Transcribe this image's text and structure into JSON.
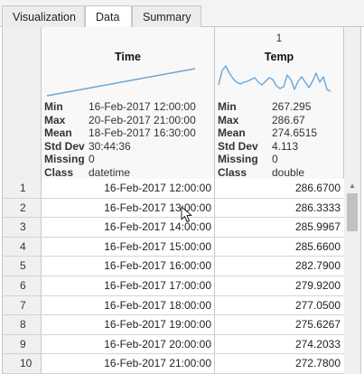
{
  "tabs": [
    {
      "label": "Visualization"
    },
    {
      "label": "Data"
    },
    {
      "label": "Summary"
    }
  ],
  "columns": {
    "time": {
      "name": "Time",
      "stats": [
        {
          "key": "Min",
          "value": "16-Feb-2017 12:00:00"
        },
        {
          "key": "Max",
          "value": "20-Feb-2017 21:00:00"
        },
        {
          "key": "Mean",
          "value": "18-Feb-2017 16:30:00"
        },
        {
          "key": "Std Dev",
          "value": "30:44:36"
        },
        {
          "key": "Missing",
          "value": "0"
        },
        {
          "key": "Class",
          "value": "datetime"
        }
      ]
    },
    "temp": {
      "number": "1",
      "name": "Temp",
      "stats": [
        {
          "key": "Min",
          "value": "267.295"
        },
        {
          "key": "Max",
          "value": "286.67"
        },
        {
          "key": "Mean",
          "value": "274.6515"
        },
        {
          "key": "Std Dev",
          "value": "4.113"
        },
        {
          "key": "Missing",
          "value": "0"
        },
        {
          "key": "Class",
          "value": "double"
        }
      ]
    }
  },
  "rows": [
    {
      "n": "1",
      "time": "16-Feb-2017 12:00:00",
      "temp": "286.6700"
    },
    {
      "n": "2",
      "time": "16-Feb-2017 13:00:00",
      "temp": "286.3333"
    },
    {
      "n": "3",
      "time": "16-Feb-2017 14:00:00",
      "temp": "285.9967"
    },
    {
      "n": "4",
      "time": "16-Feb-2017 15:00:00",
      "temp": "285.6600"
    },
    {
      "n": "5",
      "time": "16-Feb-2017 16:00:00",
      "temp": "282.7900"
    },
    {
      "n": "6",
      "time": "16-Feb-2017 17:00:00",
      "temp": "279.9200"
    },
    {
      "n": "7",
      "time": "16-Feb-2017 18:00:00",
      "temp": "277.0500"
    },
    {
      "n": "8",
      "time": "16-Feb-2017 19:00:00",
      "temp": "275.6267"
    },
    {
      "n": "9",
      "time": "16-Feb-2017 20:00:00",
      "temp": "274.2033"
    },
    {
      "n": "10",
      "time": "16-Feb-2017 21:00:00",
      "temp": "272.7800"
    }
  ],
  "colors": {
    "sparkline": "#6aa6d8",
    "grid": "#c8c8c8",
    "header_bg": "#f8f8f8",
    "scroll_thumb": "#c1c1c1"
  },
  "icons": {
    "scroll_up": "triangle-up-icon",
    "cursor": "mouse-pointer-icon"
  }
}
